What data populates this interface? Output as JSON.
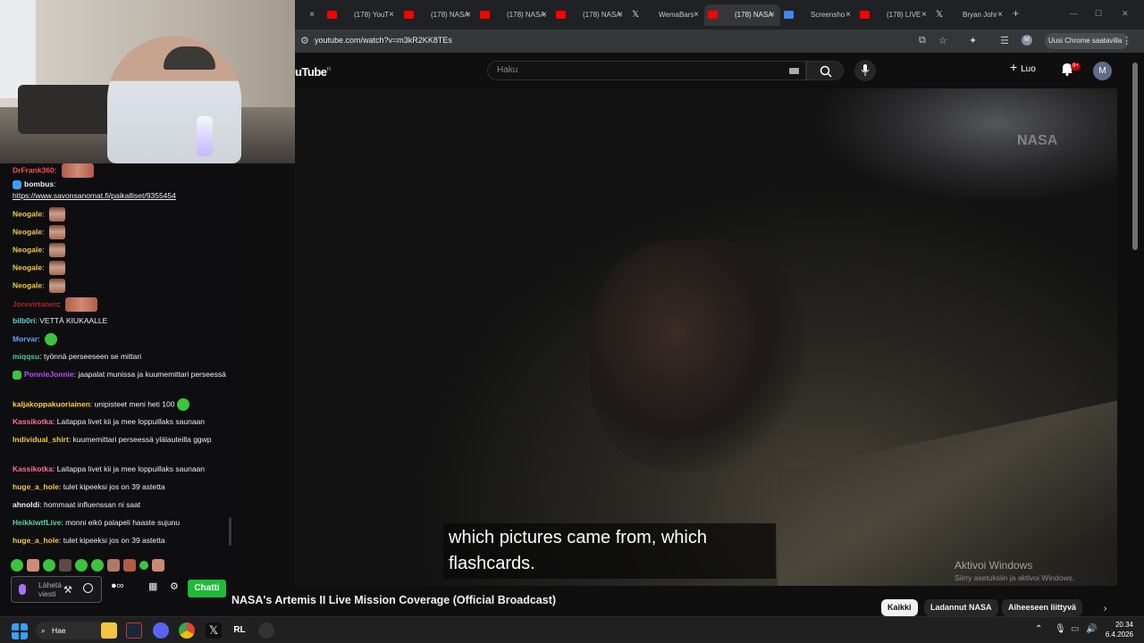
{
  "chat": {
    "messages": [
      {
        "user": "DrFrank360",
        "color": "#ff4f4f",
        "text": "",
        "emotes": [
          "red2"
        ]
      },
      {
        "user": "bombus",
        "color": "#efeff1",
        "text": "",
        "link": "https://www.savonsanomat.fi/paikalliset/9355454",
        "badge": true
      },
      {
        "user": "Neogale",
        "color": "#f2c94c",
        "text": "",
        "emotes": [
          "face"
        ]
      },
      {
        "user": "Neogale",
        "color": "#f2c94c",
        "text": "",
        "emotes": [
          "face"
        ]
      },
      {
        "user": "Neogale",
        "color": "#f2c94c",
        "text": "",
        "emotes": [
          "face"
        ]
      },
      {
        "user": "Neogale",
        "color": "#f2c94c",
        "text": "",
        "emotes": [
          "face"
        ]
      },
      {
        "user": "Neogale",
        "color": "#f2c94c",
        "text": "",
        "emotes": [
          "face"
        ]
      },
      {
        "user": "Jorevirtanen",
        "color": "#b22222",
        "text": "",
        "emotes": [
          "red2"
        ]
      },
      {
        "user": "bilb0ri",
        "color": "#5fd3d3",
        "text": "VETTÄ KIUKAALLE"
      },
      {
        "user": "Morvar",
        "color": "#6aa5ff",
        "text": "",
        "emotes": [
          "green"
        ]
      },
      {
        "user": "miqqsu",
        "color": "#4fcf8f",
        "text": "työnnä perseeseen se mittari"
      },
      {
        "user": "PonnieJonnie",
        "color": "#b94fff",
        "text": "jaapalat munissa ja kuumemittari perseessä",
        "badge": true
      },
      {
        "user": "kaljakoppakuoriainen",
        "color": "#ffd23f",
        "text": "unipisteet meni heti 100",
        "emotes": [
          "green"
        ]
      },
      {
        "user": "Kassikotka",
        "color": "#ff6f91",
        "text": "Laitappa livet kii ja mee loppuillaks saunaan"
      },
      {
        "user": "Individual_shirt",
        "color": "#f2c94c",
        "text": "kuumemittari perseessä ylälauteilla ggwp"
      },
      {
        "user": "Kassikotka",
        "color": "#ff6f91",
        "text": "Laitappa livet kii ja mee loppuillaks saunaan"
      },
      {
        "user": "huge_a_hole",
        "color": "#f2c94c",
        "text": "tulet kipeeksi jos on 39 astetta"
      },
      {
        "user": "ahnoldi",
        "color": "#efeff1",
        "text": "hommaat influenssan ni saat"
      },
      {
        "user": "HeikkiwtfLive",
        "color": "#5fd3a3",
        "text": "monni eikö palapeli haaste sujunu"
      },
      {
        "user": "huge_a_hole",
        "color": "#f2c94c",
        "text": "tulet kipeeksi jos on 39 astetta"
      }
    ],
    "input_placeholder": "Lähetä viesti",
    "send_label": "Chatti"
  },
  "browser": {
    "tabs": [
      {
        "label": "",
        "icon": "youtube-icon",
        "active": false
      },
      {
        "label": "(178) YouT",
        "icon": "youtube-icon",
        "active": false
      },
      {
        "label": "(178) NASA",
        "icon": "youtube-icon",
        "active": false
      },
      {
        "label": "(178) NASA",
        "icon": "youtube-icon",
        "active": false
      },
      {
        "label": "(178) NASA",
        "icon": "youtube-icon",
        "active": false
      },
      {
        "label": "WemaBars",
        "icon": "x-icon",
        "active": false
      },
      {
        "label": "(178) NASA",
        "icon": "youtube-icon",
        "active": true
      },
      {
        "label": "Screensho",
        "icon": "screenshot-icon",
        "active": false
      },
      {
        "label": "(178) LIVE",
        "icon": "youtube-icon",
        "active": false
      },
      {
        "label": "Bryan Johr",
        "icon": "x-icon",
        "active": false
      }
    ],
    "url": "youtube.com/watch?v=m3kR2KK8TEs",
    "profile_button": "Uusi Chrome saatavilla",
    "profile_initial": "M"
  },
  "youtube": {
    "logo": "uTube",
    "logo_region": "FI",
    "search_placeholder": "Haku",
    "create_label": "Luo",
    "notifications": "9+",
    "avatar_initial": "M",
    "watermark": "NASA",
    "caption_line1": "which pictures came from, which",
    "caption_line2": "flashcards.",
    "windows_activate_title": "Aktivoi Windows",
    "windows_activate_sub": "Siirry asetuksiin ja aktivoi Windows.",
    "video_title": "NASA's Artemis II Live Mission Coverage (Official Broadcast)",
    "chips": [
      "Kaikki",
      "Ladannut NASA",
      "Aiheeseen liittyvä"
    ]
  },
  "taskbar": {
    "search_label": "Hae",
    "time": "20.34",
    "date": "6.4.2026"
  },
  "colors": {
    "youtube_red": "#ff0000",
    "twitch_purple": "#a970ff",
    "chat_send_green": "#1fba3a"
  }
}
